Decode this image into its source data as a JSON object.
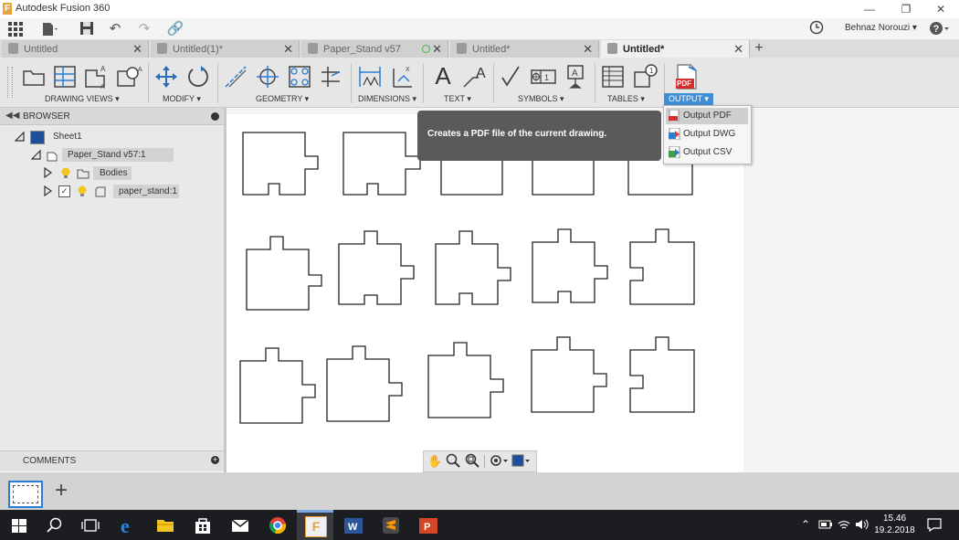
{
  "window": {
    "title": "Autodesk Fusion 360"
  },
  "user": {
    "name": "Behnaz Norouzi ▾"
  },
  "tabs": [
    {
      "label": "Untitled"
    },
    {
      "label": "Untitled(1)*"
    },
    {
      "label": "Paper_Stand v57"
    },
    {
      "label": "Untitled*"
    },
    {
      "label": "Untitled*"
    }
  ],
  "ribbon": {
    "groups": [
      {
        "label": "DRAWING VIEWS ▾"
      },
      {
        "label": "MODIFY ▾"
      },
      {
        "label": "GEOMETRY ▾"
      },
      {
        "label": "DIMENSIONS ▾"
      },
      {
        "label": "TEXT ▾"
      },
      {
        "label": "SYMBOLS ▾"
      },
      {
        "label": "TABLES ▾"
      },
      {
        "label": "OUTPUT ▾"
      }
    ],
    "pdf_text": "PDF",
    "text_glyph": "A"
  },
  "browser": {
    "title": "BROWSER",
    "items": [
      {
        "label": "Sheet1"
      },
      {
        "label": "Paper_Stand v57:1"
      },
      {
        "label": "Bodies"
      },
      {
        "label": "paper_stand:1"
      }
    ]
  },
  "comments": {
    "title": "COMMENTS"
  },
  "tooltip": {
    "text": "Creates a PDF file of the current drawing."
  },
  "output_menu": {
    "items": [
      {
        "label": "Output PDF"
      },
      {
        "label": "Output DWG"
      },
      {
        "label": "Output CSV"
      }
    ]
  },
  "taskbar": {
    "time": "15.46",
    "date": "19.2.2018"
  },
  "colors": {
    "accent": "#3f8fd5",
    "taskbar": "#1c1d20",
    "tooltip": "#5a5a5a"
  }
}
